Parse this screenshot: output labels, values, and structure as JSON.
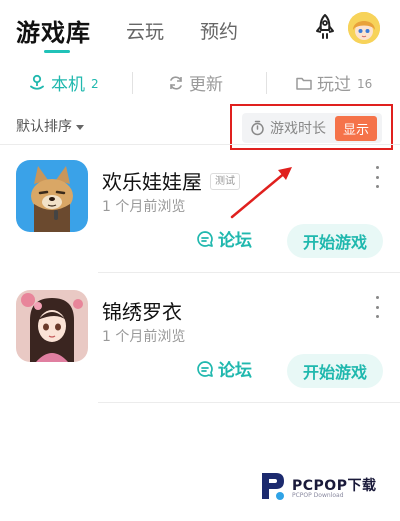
{
  "topnav": {
    "main_tab": "游戏库",
    "tabs": [
      "云玩",
      "预约"
    ]
  },
  "subtabs": {
    "local": {
      "label": "本机",
      "count": "2"
    },
    "update": {
      "label": "更新"
    },
    "played": {
      "label": "玩过",
      "count": "16"
    }
  },
  "filter": {
    "sort_label": "默认排序",
    "duration_label": "游戏时长",
    "show_label": "显示"
  },
  "games": [
    {
      "title": "欢乐娃娃屋",
      "tag": "测试",
      "subtitle": "1 个月前浏览",
      "forum_label": "论坛",
      "play_label": "开始游戏"
    },
    {
      "title": "锦绣罗衣",
      "subtitle": "1 个月前浏览",
      "forum_label": "论坛",
      "play_label": "开始游戏"
    }
  ],
  "watermark": {
    "brand": "PCPOP下载",
    "sub": "PCPOP Download"
  },
  "colors": {
    "accent": "#20b8ae",
    "badge": "#f5734a",
    "highlight": "#e0201e"
  },
  "icons": [
    "rocket-icon",
    "user-avatar",
    "local-device-icon",
    "refresh-icon",
    "folder-icon",
    "timer-icon",
    "forum-icon",
    "more-icon"
  ]
}
